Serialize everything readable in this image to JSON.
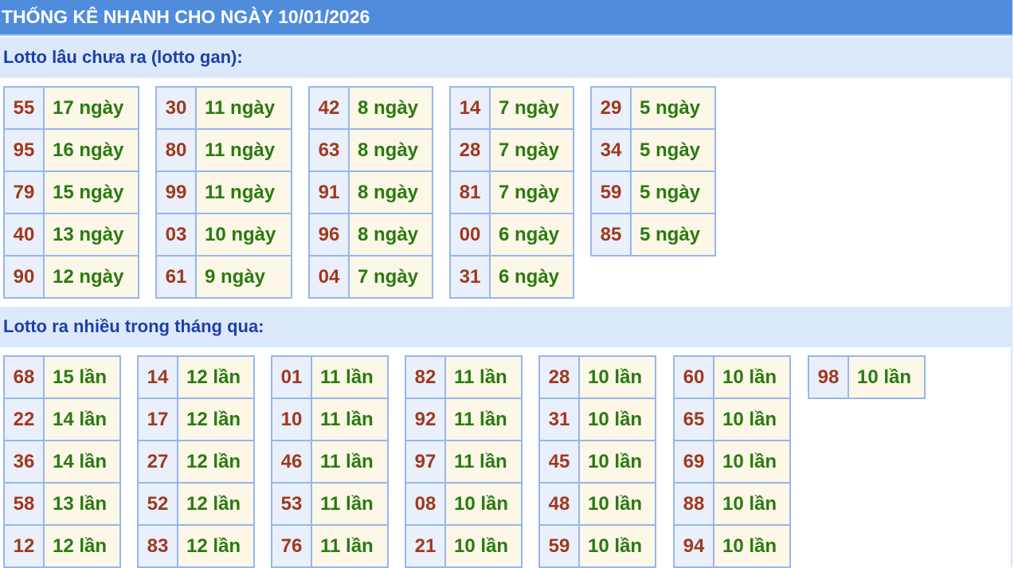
{
  "header": {
    "title": "THỐNG KÊ NHANH CHO NGÀY 10/01/2026"
  },
  "gan": {
    "title": "Lotto lâu chưa ra (lotto gan):",
    "groups": [
      {
        "rows": [
          {
            "num": "55",
            "val": "17 ngày"
          },
          {
            "num": "95",
            "val": "16 ngày"
          },
          {
            "num": "79",
            "val": "15 ngày"
          },
          {
            "num": "40",
            "val": "13 ngày"
          },
          {
            "num": "90",
            "val": "12 ngày"
          }
        ]
      },
      {
        "rows": [
          {
            "num": "30",
            "val": "11 ngày"
          },
          {
            "num": "80",
            "val": "11 ngày"
          },
          {
            "num": "99",
            "val": "11 ngày"
          },
          {
            "num": "03",
            "val": "10 ngày"
          },
          {
            "num": "61",
            "val": "9 ngày"
          }
        ]
      },
      {
        "rows": [
          {
            "num": "42",
            "val": "8 ngày"
          },
          {
            "num": "63",
            "val": "8 ngày"
          },
          {
            "num": "91",
            "val": "8 ngày"
          },
          {
            "num": "96",
            "val": "8 ngày"
          },
          {
            "num": "04",
            "val": "7 ngày"
          }
        ]
      },
      {
        "rows": [
          {
            "num": "14",
            "val": "7 ngày"
          },
          {
            "num": "28",
            "val": "7 ngày"
          },
          {
            "num": "81",
            "val": "7 ngày"
          },
          {
            "num": "00",
            "val": "6 ngày"
          },
          {
            "num": "31",
            "val": "6 ngày"
          }
        ]
      },
      {
        "rows": [
          {
            "num": "29",
            "val": "5 ngày"
          },
          {
            "num": "34",
            "val": "5 ngày"
          },
          {
            "num": "59",
            "val": "5 ngày"
          },
          {
            "num": "85",
            "val": "5 ngày"
          }
        ]
      }
    ]
  },
  "frequent": {
    "title": "Lotto ra nhiều trong tháng qua:",
    "groups": [
      {
        "rows": [
          {
            "num": "68",
            "val": "15 lần"
          },
          {
            "num": "22",
            "val": "14 lần"
          },
          {
            "num": "36",
            "val": "14 lần"
          },
          {
            "num": "58",
            "val": "13 lần"
          },
          {
            "num": "12",
            "val": "12 lần"
          }
        ]
      },
      {
        "rows": [
          {
            "num": "14",
            "val": "12 lần"
          },
          {
            "num": "17",
            "val": "12 lần"
          },
          {
            "num": "27",
            "val": "12 lần"
          },
          {
            "num": "52",
            "val": "12 lần"
          },
          {
            "num": "83",
            "val": "12 lần"
          }
        ]
      },
      {
        "rows": [
          {
            "num": "01",
            "val": "11 lần"
          },
          {
            "num": "10",
            "val": "11 lần"
          },
          {
            "num": "46",
            "val": "11 lần"
          },
          {
            "num": "53",
            "val": "11 lần"
          },
          {
            "num": "76",
            "val": "11 lần"
          }
        ]
      },
      {
        "rows": [
          {
            "num": "82",
            "val": "11 lần"
          },
          {
            "num": "92",
            "val": "11 lần"
          },
          {
            "num": "97",
            "val": "11 lần"
          },
          {
            "num": "08",
            "val": "10 lần"
          },
          {
            "num": "21",
            "val": "10 lần"
          }
        ]
      },
      {
        "rows": [
          {
            "num": "28",
            "val": "10 lần"
          },
          {
            "num": "31",
            "val": "10 lần"
          },
          {
            "num": "45",
            "val": "10 lần"
          },
          {
            "num": "48",
            "val": "10 lần"
          },
          {
            "num": "59",
            "val": "10 lần"
          }
        ]
      },
      {
        "rows": [
          {
            "num": "60",
            "val": "10 lần"
          },
          {
            "num": "65",
            "val": "10 lần"
          },
          {
            "num": "69",
            "val": "10 lần"
          },
          {
            "num": "88",
            "val": "10 lần"
          },
          {
            "num": "94",
            "val": "10 lần"
          }
        ]
      },
      {
        "rows": [
          {
            "num": "98",
            "val": "10 lần"
          }
        ]
      }
    ]
  },
  "colors": {
    "header_bg": "#4f8cdc",
    "section_bg": "#dce9fb",
    "section_title": "#1d3fa8",
    "cell_border": "#97b6ee",
    "num_text": "#a1381c",
    "val_text": "#2a7a12",
    "val_bg": "#fcf7e6"
  }
}
